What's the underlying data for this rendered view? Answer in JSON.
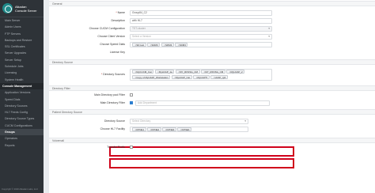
{
  "brand": {
    "line1": "Alkadan",
    "line2": "Console Server"
  },
  "sidebar": {
    "items": [
      {
        "label": "Main Server",
        "type": "item"
      },
      {
        "label": "Admin Users",
        "type": "item"
      },
      {
        "label": "FTP Servers",
        "type": "item"
      },
      {
        "label": "Backups and Restore",
        "type": "item"
      },
      {
        "label": "SSL Certificates",
        "type": "item"
      },
      {
        "label": "Server Upgrades",
        "type": "item"
      },
      {
        "label": "Server Setup",
        "type": "item"
      },
      {
        "label": "Schedule Jobs",
        "type": "item"
      },
      {
        "label": "Licensing",
        "type": "item"
      },
      {
        "label": "System Health",
        "type": "item"
      },
      {
        "label": "Console Management",
        "type": "section"
      },
      {
        "label": "Application Versions",
        "type": "item"
      },
      {
        "label": "Speed Dials",
        "type": "item"
      },
      {
        "label": "Directory Sources",
        "type": "item"
      },
      {
        "label": "HL7 Feeds Config",
        "type": "item"
      },
      {
        "label": "Directory Source Types",
        "type": "item"
      },
      {
        "label": "CUCM Configurations",
        "type": "item"
      },
      {
        "label": "Groups",
        "type": "active"
      },
      {
        "label": "Operators",
        "type": "item"
      },
      {
        "label": "Reports",
        "type": "item"
      }
    ],
    "copyright": "Copyright © 2020 Alkadan Labs, LLC"
  },
  "sections": {
    "general": "General",
    "directory_source": "Directory Source",
    "directory_filter": "Directory Filter",
    "patient_directory": "Patient Directory Source",
    "voicemail": "Voicemail"
  },
  "form": {
    "name": {
      "label": "Name",
      "value": "Group84_C2"
    },
    "description": {
      "label": "Description",
      "value": "with HL7"
    },
    "cucm": {
      "label": "Choose CUCM Configuration",
      "value": "TST-cluster"
    },
    "client_version": {
      "label": "Choose Client Version",
      "placeholder": "Select a Version"
    },
    "speed_dials": {
      "label": "Choose Speed Dials",
      "tags": [
        "SD test",
        "SDM3",
        "SDM3",
        "SDM3"
      ]
    },
    "license_key": {
      "label": "License Key",
      "value": ""
    },
    "directory_sources": {
      "label": "Directory Sources",
      "tags_row1": [
        "MyCUCM_Cat",
        "MyLDAP_1a",
        "MY_RFNSG_CM",
        "MY_RFNSG_CM",
        "MyLDAP_2"
      ],
      "tags_row2": [
        "Copy of MyLDAP_Workstation",
        "MyLDAP_Cat",
        "MyCAPTI",
        "LDAP_QA"
      ]
    },
    "main_dir_pool_filter": {
      "label": "Main Directory pool Filter"
    },
    "main_dir_filter": {
      "label": "Main Directory Filter",
      "placeholder": "Add Department"
    },
    "directory_source": {
      "label": "Directory Source",
      "placeholder": "Select Directory"
    },
    "hl7_facility": {
      "label": "Choose HL7 Facility",
      "tags": [
        "KPNE1",
        "KPNE2",
        "KPNE3",
        "KPNE4"
      ]
    },
    "transfer_prefix": {
      "label": "Transfer Prefix"
    }
  },
  "colors": {
    "sidebar": "#2e3338",
    "highlight": "#d0021b",
    "accent": "#2d7fd0"
  }
}
